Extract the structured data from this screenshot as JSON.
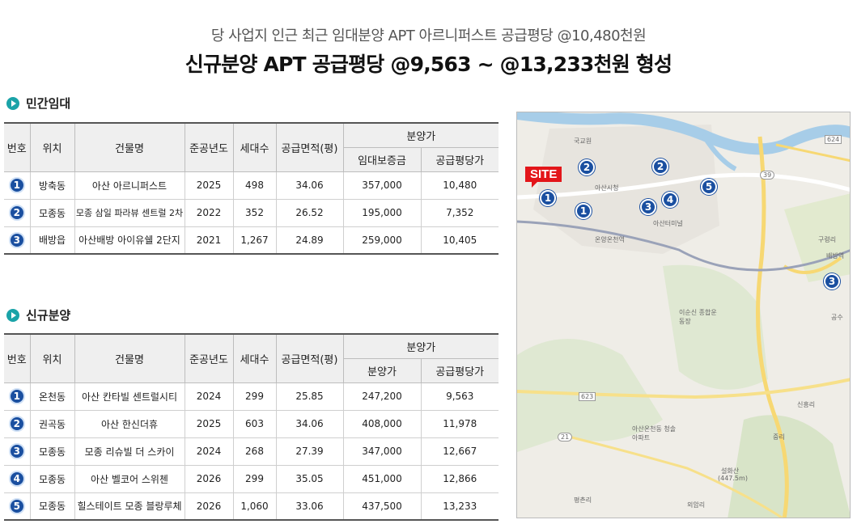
{
  "header": {
    "subtitle": "당 사업지 인근 최근 임대분양 APT 아르니퍼스트 공급평당 @10,480천원",
    "headline": "신규분양 APT 공급평당 @9,563 ~ @13,233천원 형성"
  },
  "rental": {
    "title": "민간임대",
    "columns": {
      "no": "번호",
      "location": "위치",
      "name": "건물명",
      "year": "준공년도",
      "units": "세대수",
      "area": "공급면적(평)",
      "price_group": "분양가",
      "price": "임대보증금",
      "per_pyeong": "공급평당가"
    },
    "rows": [
      {
        "no": "1",
        "location": "방축동",
        "name": "아산 아르니퍼스트",
        "year": "2025",
        "units": "498",
        "area": "34.06",
        "price": "357,000",
        "per_pyeong": "10,480"
      },
      {
        "no": "2",
        "location": "모종동",
        "name": "모종 삼일 파라뷰 센트럴 2차",
        "year": "2022",
        "units": "352",
        "area": "26.52",
        "price": "195,000",
        "per_pyeong": "7,352"
      },
      {
        "no": "3",
        "location": "배방읍",
        "name": "아산배방 아이유쉘 2단지",
        "year": "2021",
        "units": "1,267",
        "area": "24.89",
        "price": "259,000",
        "per_pyeong": "10,405"
      }
    ]
  },
  "new_sale": {
    "title": "신규분양",
    "columns": {
      "no": "번호",
      "location": "위치",
      "name": "건물명",
      "year": "준공년도",
      "units": "세대수",
      "area": "공급면적(평)",
      "price_group": "분양가",
      "price": "분양가",
      "per_pyeong": "공급평당가"
    },
    "rows": [
      {
        "no": "1",
        "location": "온천동",
        "name": "아산 칸타빌 센트럴시티",
        "year": "2024",
        "units": "299",
        "area": "25.85",
        "price": "247,200",
        "per_pyeong": "9,563"
      },
      {
        "no": "2",
        "location": "권곡동",
        "name": "아산 한신더휴",
        "year": "2025",
        "units": "603",
        "area": "34.06",
        "price": "408,000",
        "per_pyeong": "11,978"
      },
      {
        "no": "3",
        "location": "모종동",
        "name": "모종 리슈빌 더 스카이",
        "year": "2024",
        "units": "268",
        "area": "27.39",
        "price": "347,000",
        "per_pyeong": "12,667"
      },
      {
        "no": "4",
        "location": "모종동",
        "name": "아산 벨코어 스위첸",
        "year": "2026",
        "units": "299",
        "area": "35.05",
        "price": "451,000",
        "per_pyeong": "12,866"
      },
      {
        "no": "5",
        "location": "모종동",
        "name": "힐스테이트 모종 블랑루체",
        "year": "2026",
        "units": "1,060",
        "area": "33.06",
        "price": "437,500",
        "per_pyeong": "13,233"
      }
    ]
  },
  "map": {
    "site_label": "SITE",
    "labels": [
      "국교원",
      "아산시청",
      "온양온천역",
      "배방역",
      "구령리",
      "공수",
      "신흥리",
      "중리",
      "평촌리",
      "외암리",
      "설화산",
      "(447.5m)",
      "아산온천동 청솔아파트",
      "이순신 종합운동장",
      "아산터미널",
      "624",
      "623",
      "21",
      "39"
    ],
    "pins_rental": [
      "1",
      "2",
      "3"
    ],
    "pins_new": [
      "1",
      "2",
      "3",
      "4",
      "5"
    ]
  }
}
